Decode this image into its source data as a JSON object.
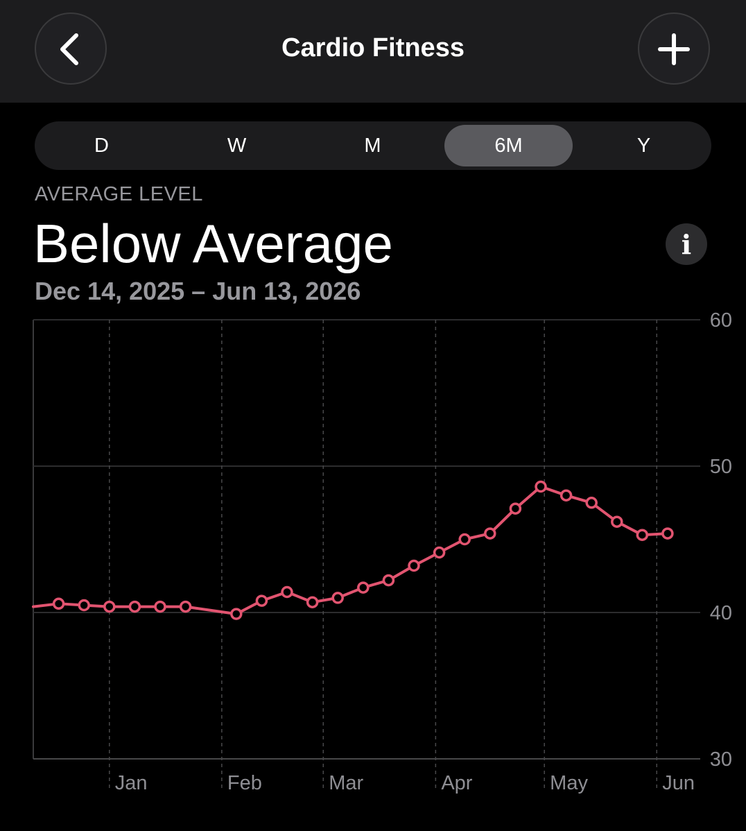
{
  "header": {
    "title": "Cardio Fitness",
    "back_icon": "chevron-left-icon",
    "add_icon": "plus-icon"
  },
  "segments": [
    "D",
    "W",
    "M",
    "6M",
    "Y"
  ],
  "selected_segment": "6M",
  "summary": {
    "label": "AVERAGE LEVEL",
    "value": "Below Average",
    "date_range": "Dec 14, 2025 – Jun 13, 2026",
    "info_icon": "i"
  },
  "chart_data": {
    "type": "line",
    "x_tick_labels": [
      "Jan",
      "Feb",
      "Mar",
      "Apr",
      "May",
      "Jun"
    ],
    "y_tick_labels": [
      "60",
      "50",
      "40",
      "30"
    ],
    "ylim": [
      30,
      60
    ],
    "grid": true,
    "series": [
      {
        "color": "#e25470",
        "points": [
          {
            "x": "2025-12-18",
            "y": 40.6
          },
          {
            "x": "2025-12-25",
            "y": 40.5
          },
          {
            "x": "2026-01-01",
            "y": 40.4
          },
          {
            "x": "2026-01-08",
            "y": 40.4
          },
          {
            "x": "2026-01-15",
            "y": 40.4
          },
          {
            "x": "2026-01-22",
            "y": 40.4
          },
          {
            "x": "2026-02-05",
            "y": 39.9
          },
          {
            "x": "2026-02-12",
            "y": 40.8
          },
          {
            "x": "2026-02-19",
            "y": 41.4
          },
          {
            "x": "2026-02-26",
            "y": 40.7
          },
          {
            "x": "2026-03-05",
            "y": 41.0
          },
          {
            "x": "2026-03-12",
            "y": 41.7
          },
          {
            "x": "2026-03-19",
            "y": 42.2
          },
          {
            "x": "2026-03-26",
            "y": 43.2
          },
          {
            "x": "2026-04-02",
            "y": 44.1
          },
          {
            "x": "2026-04-09",
            "y": 45.0
          },
          {
            "x": "2026-04-16",
            "y": 45.4
          },
          {
            "x": "2026-04-23",
            "y": 47.1
          },
          {
            "x": "2026-04-30",
            "y": 48.6
          },
          {
            "x": "2026-05-07",
            "y": 48.0
          },
          {
            "x": "2026-05-14",
            "y": 47.5
          },
          {
            "x": "2026-05-21",
            "y": 46.2
          },
          {
            "x": "2026-05-28",
            "y": 45.3
          },
          {
            "x": "2026-06-04",
            "y": 45.4
          }
        ]
      }
    ]
  }
}
